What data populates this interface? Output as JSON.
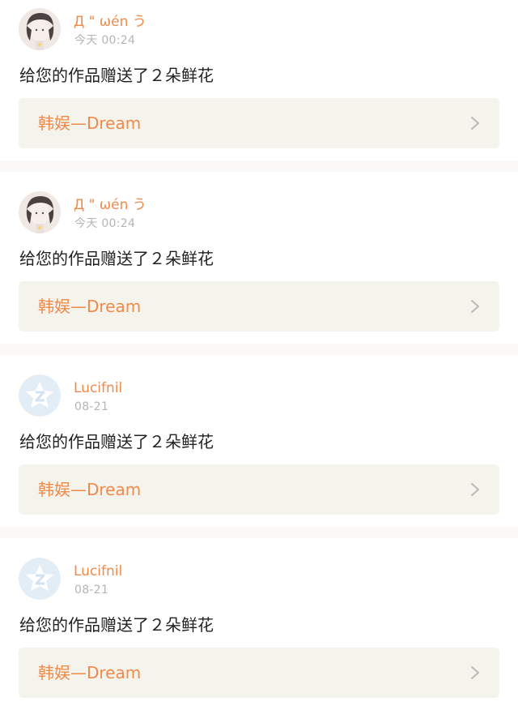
{
  "notifications": [
    {
      "avatar_icon": "user-photo-avatar",
      "username": "Д \" ωén う",
      "time": "今天 00:24",
      "message": "给您的作品赠送了２朵鲜花",
      "work_title": "韩娱—Dream",
      "chevron_icon": "chevron-right-icon"
    },
    {
      "avatar_icon": "user-photo-avatar",
      "username": "Д \" ωén う",
      "time": "今天 00:24",
      "message": "给您的作品赠送了２朵鲜花",
      "work_title": "韩娱—Dream",
      "chevron_icon": "chevron-right-icon"
    },
    {
      "avatar_icon": "default-star-avatar",
      "username": "Lucifnil",
      "time": "08-21",
      "message": "给您的作品赠送了２朵鲜花",
      "work_title": "韩娱—Dream",
      "chevron_icon": "chevron-right-icon"
    },
    {
      "avatar_icon": "default-star-avatar",
      "username": "Lucifnil",
      "time": "08-21",
      "message": "给您的作品赠送了２朵鲜花",
      "work_title": "韩娱—Dream",
      "chevron_icon": "chevron-right-icon"
    }
  ],
  "colors": {
    "accent": "#f08a4b",
    "time_text": "#b5b5b5",
    "body_text": "#222222",
    "work_bg": "#f4f4ec",
    "page_bg": "#fbf8f8",
    "default_avatar_bg": "#e3edf6",
    "default_avatar_star": "#ffffff"
  }
}
